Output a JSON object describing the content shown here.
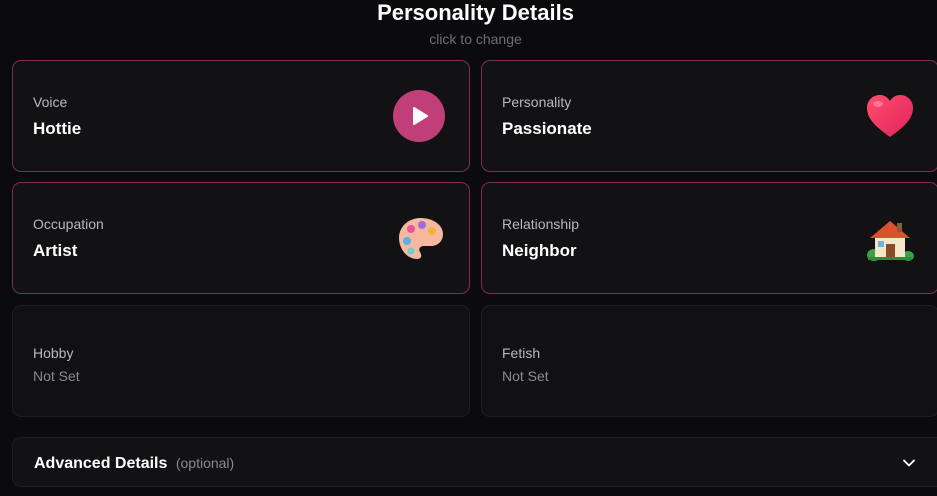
{
  "header": {
    "title": "Personality Details",
    "subtitle": "click to change"
  },
  "cards": {
    "voice": {
      "label": "Voice",
      "value": "Hottie",
      "icon": "play-icon"
    },
    "personality": {
      "label": "Personality",
      "value": "Passionate",
      "icon": "heart-icon"
    },
    "occupation": {
      "label": "Occupation",
      "value": "Artist",
      "icon": "palette-icon"
    },
    "relationship": {
      "label": "Relationship",
      "value": "Neighbor",
      "icon": "house-icon"
    },
    "hobby": {
      "label": "Hobby",
      "value": "Not Set"
    },
    "fetish": {
      "label": "Fetish",
      "value": "Not Set"
    }
  },
  "advanced": {
    "title": "Advanced Details",
    "optional": "(optional)",
    "icon": "chevron-down-icon"
  },
  "colors": {
    "accent_border": "#7c2f4e",
    "play_button": "#c13f79",
    "background": "#0b0b0d"
  }
}
